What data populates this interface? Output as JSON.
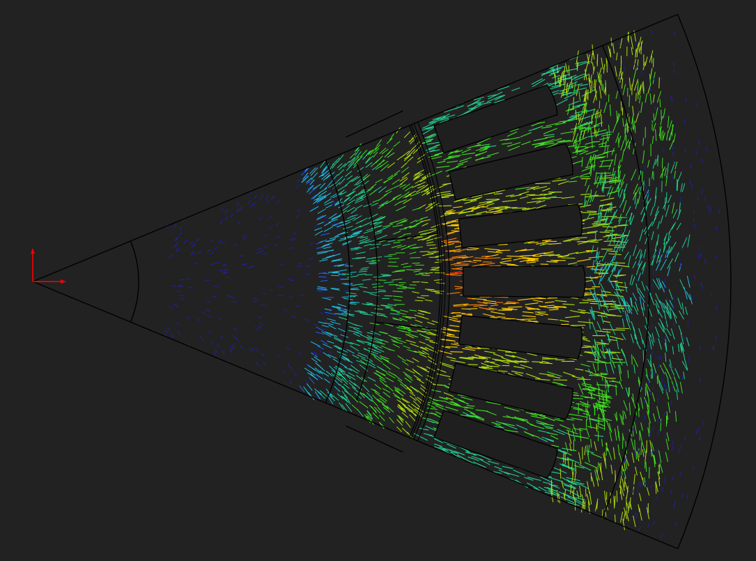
{
  "viewport": {
    "background": "#222222",
    "outline_color": "#000000"
  },
  "axis_triad": {
    "x_color": "#ff0000",
    "y_color": "#ff0000"
  },
  "colormap": [
    "#2020c0",
    "#2060ff",
    "#20c0e0",
    "#20d090",
    "#40e020",
    "#b0e010",
    "#ffd000",
    "#ff8000",
    "#ff2000"
  ],
  "model": {
    "sector_half_angle_deg": 22.5,
    "stator_slots": 6,
    "rotor_poles": 2
  }
}
